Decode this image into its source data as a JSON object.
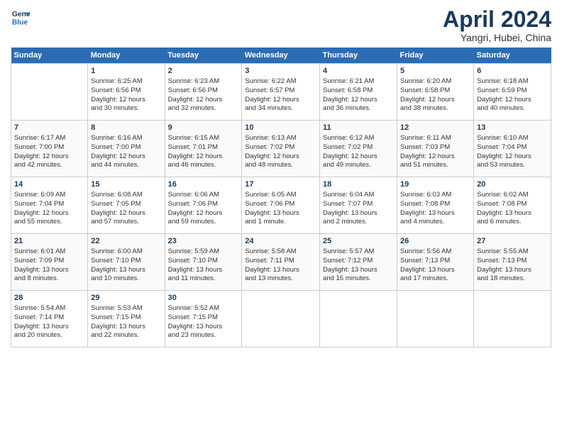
{
  "logo": {
    "line1": "General",
    "line2": "Blue"
  },
  "title": "April 2024",
  "subtitle": "Yangri, Hubei, China",
  "days_header": [
    "Sunday",
    "Monday",
    "Tuesday",
    "Wednesday",
    "Thursday",
    "Friday",
    "Saturday"
  ],
  "weeks": [
    [
      {
        "day": "",
        "content": ""
      },
      {
        "day": "1",
        "content": "Sunrise: 6:25 AM\nSunset: 6:56 PM\nDaylight: 12 hours\nand 30 minutes."
      },
      {
        "day": "2",
        "content": "Sunrise: 6:23 AM\nSunset: 6:56 PM\nDaylight: 12 hours\nand 32 minutes."
      },
      {
        "day": "3",
        "content": "Sunrise: 6:22 AM\nSunset: 6:57 PM\nDaylight: 12 hours\nand 34 minutes."
      },
      {
        "day": "4",
        "content": "Sunrise: 6:21 AM\nSunset: 6:58 PM\nDaylight: 12 hours\nand 36 minutes."
      },
      {
        "day": "5",
        "content": "Sunrise: 6:20 AM\nSunset: 6:58 PM\nDaylight: 12 hours\nand 38 minutes."
      },
      {
        "day": "6",
        "content": "Sunrise: 6:18 AM\nSunset: 6:59 PM\nDaylight: 12 hours\nand 40 minutes."
      }
    ],
    [
      {
        "day": "7",
        "content": "Sunrise: 6:17 AM\nSunset: 7:00 PM\nDaylight: 12 hours\nand 42 minutes."
      },
      {
        "day": "8",
        "content": "Sunrise: 6:16 AM\nSunset: 7:00 PM\nDaylight: 12 hours\nand 44 minutes."
      },
      {
        "day": "9",
        "content": "Sunrise: 6:15 AM\nSunset: 7:01 PM\nDaylight: 12 hours\nand 46 minutes."
      },
      {
        "day": "10",
        "content": "Sunrise: 6:13 AM\nSunset: 7:02 PM\nDaylight: 12 hours\nand 48 minutes."
      },
      {
        "day": "11",
        "content": "Sunrise: 6:12 AM\nSunset: 7:02 PM\nDaylight: 12 hours\nand 49 minutes."
      },
      {
        "day": "12",
        "content": "Sunrise: 6:11 AM\nSunset: 7:03 PM\nDaylight: 12 hours\nand 51 minutes."
      },
      {
        "day": "13",
        "content": "Sunrise: 6:10 AM\nSunset: 7:04 PM\nDaylight: 12 hours\nand 53 minutes."
      }
    ],
    [
      {
        "day": "14",
        "content": "Sunrise: 6:09 AM\nSunset: 7:04 PM\nDaylight: 12 hours\nand 55 minutes."
      },
      {
        "day": "15",
        "content": "Sunrise: 6:08 AM\nSunset: 7:05 PM\nDaylight: 12 hours\nand 57 minutes."
      },
      {
        "day": "16",
        "content": "Sunrise: 6:06 AM\nSunset: 7:06 PM\nDaylight: 12 hours\nand 59 minutes."
      },
      {
        "day": "17",
        "content": "Sunrise: 6:05 AM\nSunset: 7:06 PM\nDaylight: 13 hours\nand 1 minute."
      },
      {
        "day": "18",
        "content": "Sunrise: 6:04 AM\nSunset: 7:07 PM\nDaylight: 13 hours\nand 2 minutes."
      },
      {
        "day": "19",
        "content": "Sunrise: 6:03 AM\nSunset: 7:08 PM\nDaylight: 13 hours\nand 4 minutes."
      },
      {
        "day": "20",
        "content": "Sunrise: 6:02 AM\nSunset: 7:08 PM\nDaylight: 13 hours\nand 6 minutes."
      }
    ],
    [
      {
        "day": "21",
        "content": "Sunrise: 6:01 AM\nSunset: 7:09 PM\nDaylight: 13 hours\nand 8 minutes."
      },
      {
        "day": "22",
        "content": "Sunrise: 6:00 AM\nSunset: 7:10 PM\nDaylight: 13 hours\nand 10 minutes."
      },
      {
        "day": "23",
        "content": "Sunrise: 5:59 AM\nSunset: 7:10 PM\nDaylight: 13 hours\nand 11 minutes."
      },
      {
        "day": "24",
        "content": "Sunrise: 5:58 AM\nSunset: 7:11 PM\nDaylight: 13 hours\nand 13 minutes."
      },
      {
        "day": "25",
        "content": "Sunrise: 5:57 AM\nSunset: 7:12 PM\nDaylight: 13 hours\nand 15 minutes."
      },
      {
        "day": "26",
        "content": "Sunrise: 5:56 AM\nSunset: 7:13 PM\nDaylight: 13 hours\nand 17 minutes."
      },
      {
        "day": "27",
        "content": "Sunrise: 5:55 AM\nSunset: 7:13 PM\nDaylight: 13 hours\nand 18 minutes."
      }
    ],
    [
      {
        "day": "28",
        "content": "Sunrise: 5:54 AM\nSunset: 7:14 PM\nDaylight: 13 hours\nand 20 minutes."
      },
      {
        "day": "29",
        "content": "Sunrise: 5:53 AM\nSunset: 7:15 PM\nDaylight: 13 hours\nand 22 minutes."
      },
      {
        "day": "30",
        "content": "Sunrise: 5:52 AM\nSunset: 7:15 PM\nDaylight: 13 hours\nand 23 minutes."
      },
      {
        "day": "",
        "content": ""
      },
      {
        "day": "",
        "content": ""
      },
      {
        "day": "",
        "content": ""
      },
      {
        "day": "",
        "content": ""
      }
    ]
  ]
}
